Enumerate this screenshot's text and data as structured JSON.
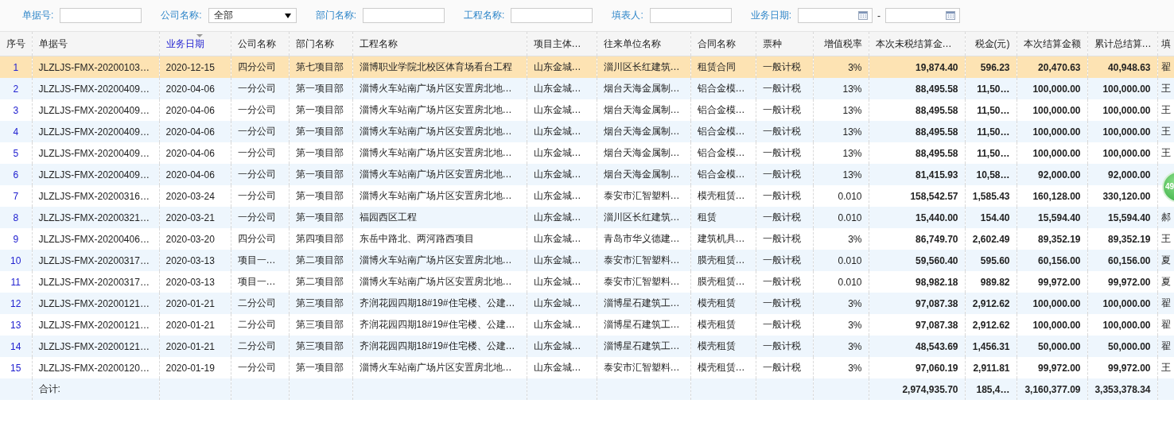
{
  "filters": [
    {
      "kind": "text",
      "label": "单据号:"
    },
    {
      "kind": "select",
      "label": "公司名称:",
      "value": "全部"
    },
    {
      "kind": "text",
      "label": "部门名称:"
    },
    {
      "kind": "text",
      "label": "工程名称:"
    },
    {
      "kind": "text",
      "label": "填表人:"
    },
    {
      "kind": "daterange",
      "label": "业务日期:",
      "separator": "-"
    }
  ],
  "table": {
    "columns": [
      {
        "label": "序号",
        "kind": "index",
        "sorted": false
      },
      {
        "label": "单据号",
        "kind": "text",
        "sorted": false
      },
      {
        "label": "业务日期",
        "kind": "text",
        "sorted": true
      },
      {
        "label": "公司名称",
        "kind": "text",
        "sorted": false
      },
      {
        "label": "部门名称",
        "kind": "text",
        "sorted": false
      },
      {
        "label": "工程名称",
        "kind": "text",
        "sorted": false
      },
      {
        "label": "项目主体…",
        "kind": "text",
        "sorted": false
      },
      {
        "label": "往来单位名称",
        "kind": "text",
        "sorted": false
      },
      {
        "label": "合同名称",
        "kind": "text",
        "sorted": false
      },
      {
        "label": "票种",
        "kind": "text",
        "sorted": false
      },
      {
        "label": "增值税率",
        "kind": "number",
        "sorted": false
      },
      {
        "label": "本次未税结算金…",
        "kind": "amount",
        "sorted": false
      },
      {
        "label": "税金(元)",
        "kind": "amount",
        "sorted": false
      },
      {
        "label": "本次结算金额",
        "kind": "amount",
        "sorted": false
      },
      {
        "label": "累计总结算…",
        "kind": "amount",
        "sorted": false
      },
      {
        "label": "填",
        "kind": "text",
        "sorted": false
      }
    ],
    "rows": [
      {
        "selected": true,
        "cells": [
          "1",
          "JLZLJS-FMX-20200103…",
          "2020-12-15",
          "四分公司",
          "第七项目部",
          "淄博职业学院北校区体育场看台工程",
          "山东金城…",
          "淄川区长红建筑…",
          "租赁合同",
          "一般计税",
          "3%",
          "19,874.40",
          "596.23",
          "20,470.63",
          "40,948.63",
          "翟"
        ]
      },
      {
        "selected": false,
        "cells": [
          "2",
          "JLZLJS-FMX-20200409…",
          "2020-04-06",
          "一分公司",
          "第一项目部",
          "淄博火车站南广场片区安置房北地…",
          "山东金城…",
          "烟台天海金属制…",
          "铝合金模…",
          "一般计税",
          "13%",
          "88,495.58",
          "11,50…",
          "100,000.00",
          "100,000.00",
          "王"
        ]
      },
      {
        "selected": false,
        "cells": [
          "3",
          "JLZLJS-FMX-20200409…",
          "2020-04-06",
          "一分公司",
          "第一项目部",
          "淄博火车站南广场片区安置房北地…",
          "山东金城…",
          "烟台天海金属制…",
          "铝合金模…",
          "一般计税",
          "13%",
          "88,495.58",
          "11,50…",
          "100,000.00",
          "100,000.00",
          "王"
        ]
      },
      {
        "selected": false,
        "cells": [
          "4",
          "JLZLJS-FMX-20200409…",
          "2020-04-06",
          "一分公司",
          "第一项目部",
          "淄博火车站南广场片区安置房北地…",
          "山东金城…",
          "烟台天海金属制…",
          "铝合金模…",
          "一般计税",
          "13%",
          "88,495.58",
          "11,50…",
          "100,000.00",
          "100,000.00",
          "王"
        ]
      },
      {
        "selected": false,
        "cells": [
          "5",
          "JLZLJS-FMX-20200409…",
          "2020-04-06",
          "一分公司",
          "第一项目部",
          "淄博火车站南广场片区安置房北地…",
          "山东金城…",
          "烟台天海金属制…",
          "铝合金模…",
          "一般计税",
          "13%",
          "88,495.58",
          "11,50…",
          "100,000.00",
          "100,000.00",
          "王"
        ]
      },
      {
        "selected": false,
        "cells": [
          "6",
          "JLZLJS-FMX-20200409…",
          "2020-04-06",
          "一分公司",
          "第一项目部",
          "淄博火车站南广场片区安置房北地…",
          "山东金城…",
          "烟台天海金属制…",
          "铝合金模…",
          "一般计税",
          "13%",
          "81,415.93",
          "10,58…",
          "92,000.00",
          "92,000.00"
        ]
      },
      {
        "selected": false,
        "cells": [
          "7",
          "JLZLJS-FMX-20200316…",
          "2020-03-24",
          "一分公司",
          "第一项目部",
          "淄博火车站南广场片区安置房北地…",
          "山东金城…",
          "泰安市汇智塑料…",
          "模壳租赁…",
          "一般计税",
          "0.010",
          "158,542.57",
          "1,585.43",
          "160,128.00",
          "330,120.00"
        ]
      },
      {
        "selected": false,
        "cells": [
          "8",
          "JLZLJS-FMX-20200321…",
          "2020-03-21",
          "一分公司",
          "第一项目部",
          "福园西区工程",
          "山东金城…",
          "淄川区长红建筑…",
          "租赁",
          "一般计税",
          "0.010",
          "15,440.00",
          "154.40",
          "15,594.40",
          "15,594.40",
          "郝"
        ]
      },
      {
        "selected": false,
        "cells": [
          "9",
          "JLZLJS-FMX-20200406…",
          "2020-03-20",
          "四分公司",
          "第四项目部",
          "东岳中路北、两河路西项目",
          "山东金城…",
          "青岛市华义德建…",
          "建筑机具…",
          "一般计税",
          "3%",
          "86,749.70",
          "2,602.49",
          "89,352.19",
          "89,352.19",
          "王"
        ]
      },
      {
        "selected": false,
        "cells": [
          "10",
          "JLZLJS-FMX-20200317…",
          "2020-03-13",
          "项目一…",
          "第二项目部",
          "淄博火车站南广场片区安置房北地…",
          "山东金城…",
          "泰安市汇智塑料…",
          "膜壳租赁…",
          "一般计税",
          "0.010",
          "59,560.40",
          "595.60",
          "60,156.00",
          "60,156.00",
          "夏"
        ]
      },
      {
        "selected": false,
        "cells": [
          "11",
          "JLZLJS-FMX-20200317…",
          "2020-03-13",
          "项目一…",
          "第二项目部",
          "淄博火车站南广场片区安置房北地…",
          "山东金城…",
          "泰安市汇智塑料…",
          "膜壳租赁…",
          "一般计税",
          "0.010",
          "98,982.18",
          "989.82",
          "99,972.00",
          "99,972.00",
          "夏"
        ]
      },
      {
        "selected": false,
        "cells": [
          "12",
          "JLZLJS-FMX-20200121…",
          "2020-01-21",
          "二分公司",
          "第三项目部",
          "齐润花园四期18#19#住宅楼、公建…",
          "山东金城…",
          "淄博星石建筑工…",
          "模壳租赁",
          "一般计税",
          "3%",
          "97,087.38",
          "2,912.62",
          "100,000.00",
          "100,000.00",
          "翟"
        ]
      },
      {
        "selected": false,
        "cells": [
          "13",
          "JLZLJS-FMX-20200121…",
          "2020-01-21",
          "二分公司",
          "第三项目部",
          "齐润花园四期18#19#住宅楼、公建…",
          "山东金城…",
          "淄博星石建筑工…",
          "模壳租赁",
          "一般计税",
          "3%",
          "97,087.38",
          "2,912.62",
          "100,000.00",
          "100,000.00",
          "翟"
        ]
      },
      {
        "selected": false,
        "cells": [
          "14",
          "JLZLJS-FMX-20200121…",
          "2020-01-21",
          "二分公司",
          "第三项目部",
          "齐润花园四期18#19#住宅楼、公建…",
          "山东金城…",
          "淄博星石建筑工…",
          "模壳租赁",
          "一般计税",
          "3%",
          "48,543.69",
          "1,456.31",
          "50,000.00",
          "50,000.00",
          "翟"
        ]
      },
      {
        "selected": false,
        "cells": [
          "15",
          "JLZLJS-FMX-20200120…",
          "2020-01-19",
          "一分公司",
          "第一项目部",
          "淄博火车站南广场片区安置房北地…",
          "山东金城…",
          "泰安市汇智塑料…",
          "模壳租赁…",
          "一般计税",
          "3%",
          "97,060.19",
          "2,911.81",
          "99,972.00",
          "99,972.00",
          "王"
        ]
      }
    ],
    "total_row": {
      "label": "合计:",
      "amounts": [
        "2,974,935.70",
        "185,4…",
        "3,160,377.09",
        "3,353,378.34"
      ]
    }
  },
  "floating_badge": {
    "text": "49"
  }
}
